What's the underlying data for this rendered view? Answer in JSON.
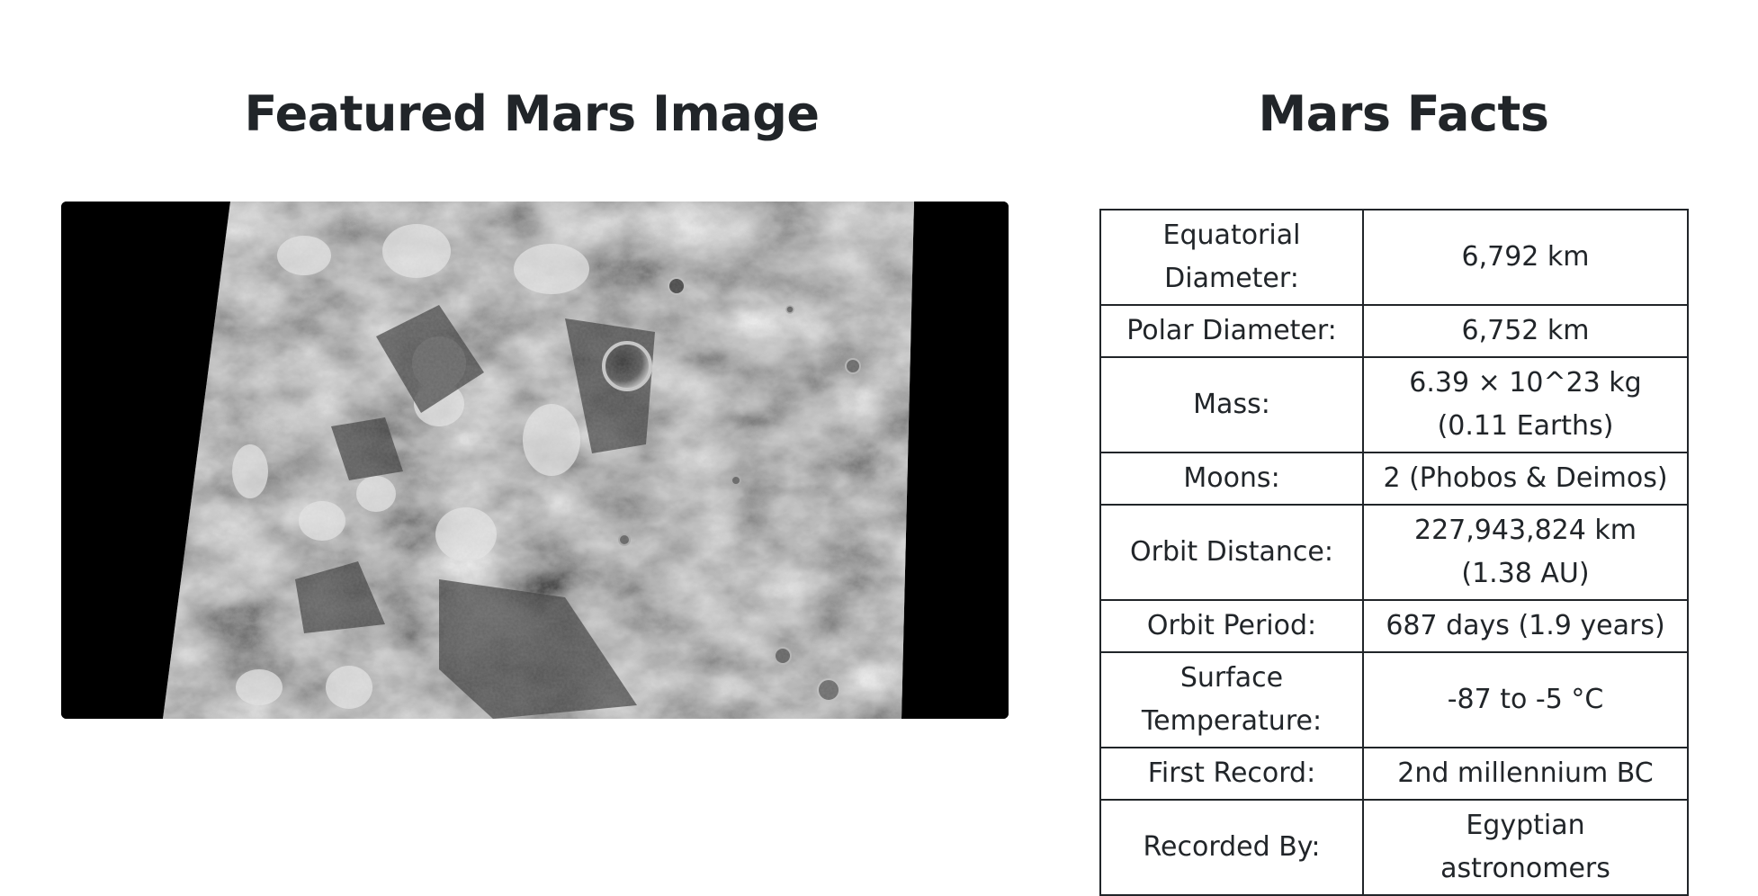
{
  "featured": {
    "heading": "Featured Mars Image"
  },
  "facts": {
    "heading": "Mars Facts",
    "rows": [
      {
        "label": "Equatorial Diameter:",
        "value": "6,792 km"
      },
      {
        "label": "Polar Diameter:",
        "value": "6,752 km"
      },
      {
        "label": "Mass:",
        "value": "6.39 × 10^23 kg (0.11 Earths)"
      },
      {
        "label": "Moons:",
        "value": "2 (Phobos & Deimos)"
      },
      {
        "label": "Orbit Distance:",
        "value": "227,943,824 km (1.38 AU)"
      },
      {
        "label": "Orbit Period:",
        "value": "687 days (1.9 years)"
      },
      {
        "label": "Surface Temperature:",
        "value": "-87 to -5 °C"
      },
      {
        "label": "First Record:",
        "value": "2nd millennium BC"
      },
      {
        "label": "Recorded By:",
        "value": "Egyptian astronomers"
      }
    ]
  }
}
